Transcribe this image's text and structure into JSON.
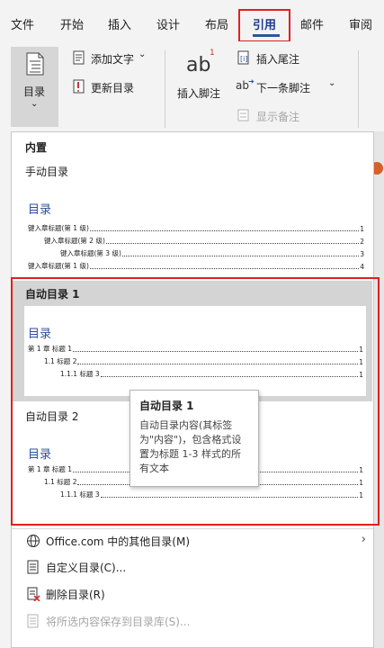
{
  "tabs": [
    "文件",
    "开始",
    "插入",
    "设计",
    "布局",
    "引用",
    "邮件",
    "审阅"
  ],
  "ribbon": {
    "toc_label": "目录",
    "add_text": "添加文字",
    "update_toc": "更新目录",
    "footnote_glyph": "ab",
    "footnote_sup": "1",
    "insert_footnote": "插入脚注",
    "insert_endnote": "插入尾注",
    "next_footnote_glyph": "ab",
    "next_footnote": "下一条脚注",
    "show_notes": "显示备注"
  },
  "dropdown": {
    "builtin_header": "内置",
    "manual_toc": "手动目录",
    "manual_preview": {
      "title": "目录",
      "rows": [
        {
          "text": "键入章标题(第 1 级)",
          "page": "1"
        },
        {
          "text": "键入章标题(第 2 级)",
          "page": "2"
        },
        {
          "text": "键入章标题(第 3 级)",
          "page": "3"
        },
        {
          "text": "键入章标题(第 1 级)",
          "page": "4"
        }
      ]
    },
    "auto1_header": "自动目录 1",
    "auto1_preview": {
      "title": "目录",
      "rows": [
        {
          "text": "第 1 章  标题 1",
          "page": "1"
        },
        {
          "text": "1.1  标题 2",
          "page": "1"
        },
        {
          "text": "1.1.1  标题 3",
          "page": "1"
        }
      ]
    },
    "auto2_header": "自动目录 2",
    "auto2_preview": {
      "title": "目录",
      "rows": [
        {
          "text": "第 1 章  标题 1",
          "page": "1"
        },
        {
          "text": "1.1  标题 2",
          "page": "1"
        },
        {
          "text": "1.1.1  标题 3",
          "page": "1"
        }
      ]
    },
    "tooltip": {
      "title": "自动目录 1",
      "body": "自动目录内容(其标签为\"内容\")，包含格式设置为标题 1-3 样式的所有文本"
    },
    "menu": [
      {
        "label": "Office.com 中的其他目录(M)",
        "icon": "globe-icon"
      },
      {
        "label": "自定义目录(C)...",
        "icon": "custom-toc-icon"
      },
      {
        "label": "删除目录(R)",
        "icon": "remove-toc-icon"
      },
      {
        "label": "将所选内容保存到目录库(S)...",
        "icon": "save-selection-icon"
      }
    ]
  },
  "colors": {
    "accent": "#2b579a",
    "highlight_box": "#e02020",
    "toc_title": "#2b4fa0"
  }
}
